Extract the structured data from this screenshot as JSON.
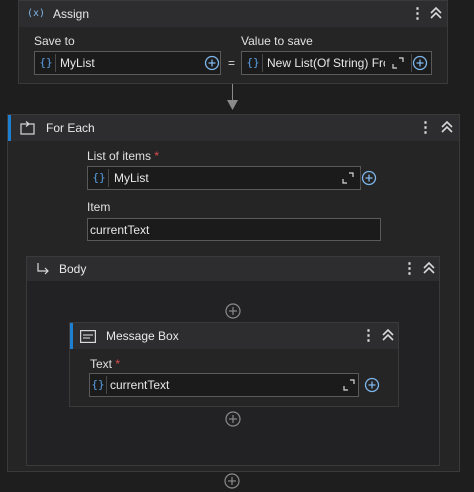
{
  "assign": {
    "title": "Assign",
    "icon_text": "(x)",
    "save_to_label": "Save to",
    "save_to_value": "MyList",
    "equals": "=",
    "value_to_save_label": "Value to save",
    "value_to_save_value": "New List(Of String) Frc"
  },
  "for_each": {
    "title": "For Each",
    "list_of_items_label": "List of items",
    "list_of_items_required": "*",
    "list_of_items_value": "MyList",
    "item_label": "Item",
    "item_value": "currentText"
  },
  "body": {
    "title": "Body"
  },
  "message_box": {
    "title": "Message Box",
    "text_label": "Text",
    "text_required": "*",
    "text_value": "currentText"
  },
  "colors": {
    "accent": "#1e7fd0",
    "required": "#e04b4b",
    "variable_brace": "#5aa0e6"
  },
  "icons": {
    "more": "kebab-vertical",
    "collapse": "chevron-double-up",
    "add": "plus-circle",
    "expand": "expand-arrows",
    "variable": "curly-braces"
  }
}
